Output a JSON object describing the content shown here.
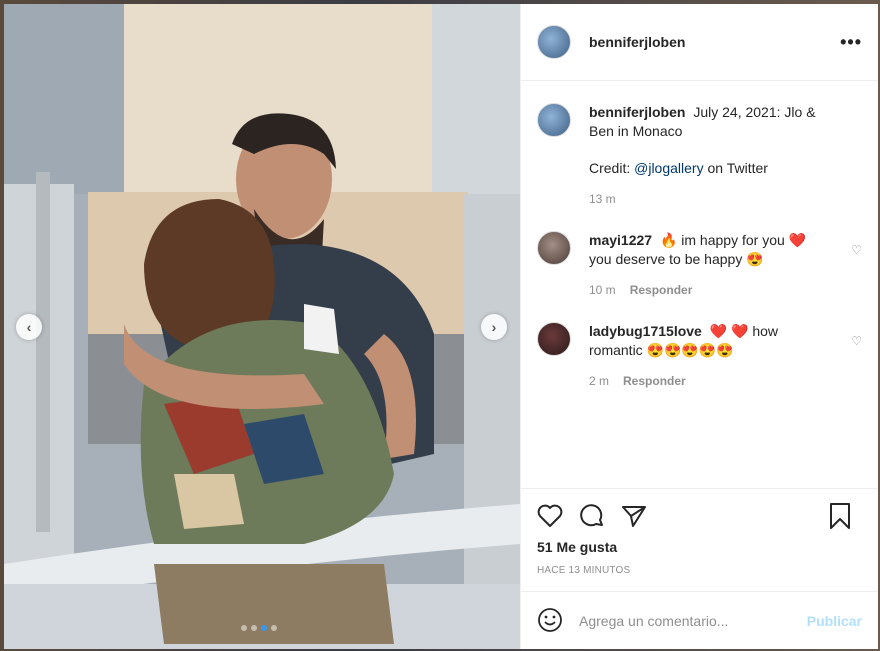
{
  "post": {
    "username": "benniferjloben",
    "caption_user": "benniferjloben",
    "caption_text": "July 24, 2021: Jlo & Ben in Monaco",
    "credit_prefix": "Credit: ",
    "credit_mention": "@jlogallery",
    "credit_suffix": " on Twitter",
    "caption_time": "13 m",
    "likes": "51 Me gusta",
    "posted_ago": "HACE 13 MINUTOS",
    "carousel_total": 4,
    "carousel_active": 3
  },
  "comments": [
    {
      "user": "mayi1227",
      "text": "🔥 im happy for you ❤️ you deserve to be happy 😍",
      "time": "10 m",
      "reply": "Responder"
    },
    {
      "user": "ladybug1715love",
      "text": "❤️ ❤️ how romantic 😍😍😍😍😍",
      "time": "2 m",
      "reply": "Responder"
    }
  ],
  "composer": {
    "placeholder": "Agrega un comentario...",
    "post_label": "Publicar"
  },
  "icons": {
    "more": "more-options-icon",
    "like": "heart-icon",
    "comment": "comment-icon",
    "share": "share-icon",
    "save": "bookmark-icon",
    "emoji": "smiley-icon",
    "prev": "chevron-left-icon",
    "next": "chevron-right-icon"
  },
  "colors": {
    "link": "#00376b",
    "active_dot": "#3897f0",
    "post_button": "#b2dffc"
  }
}
